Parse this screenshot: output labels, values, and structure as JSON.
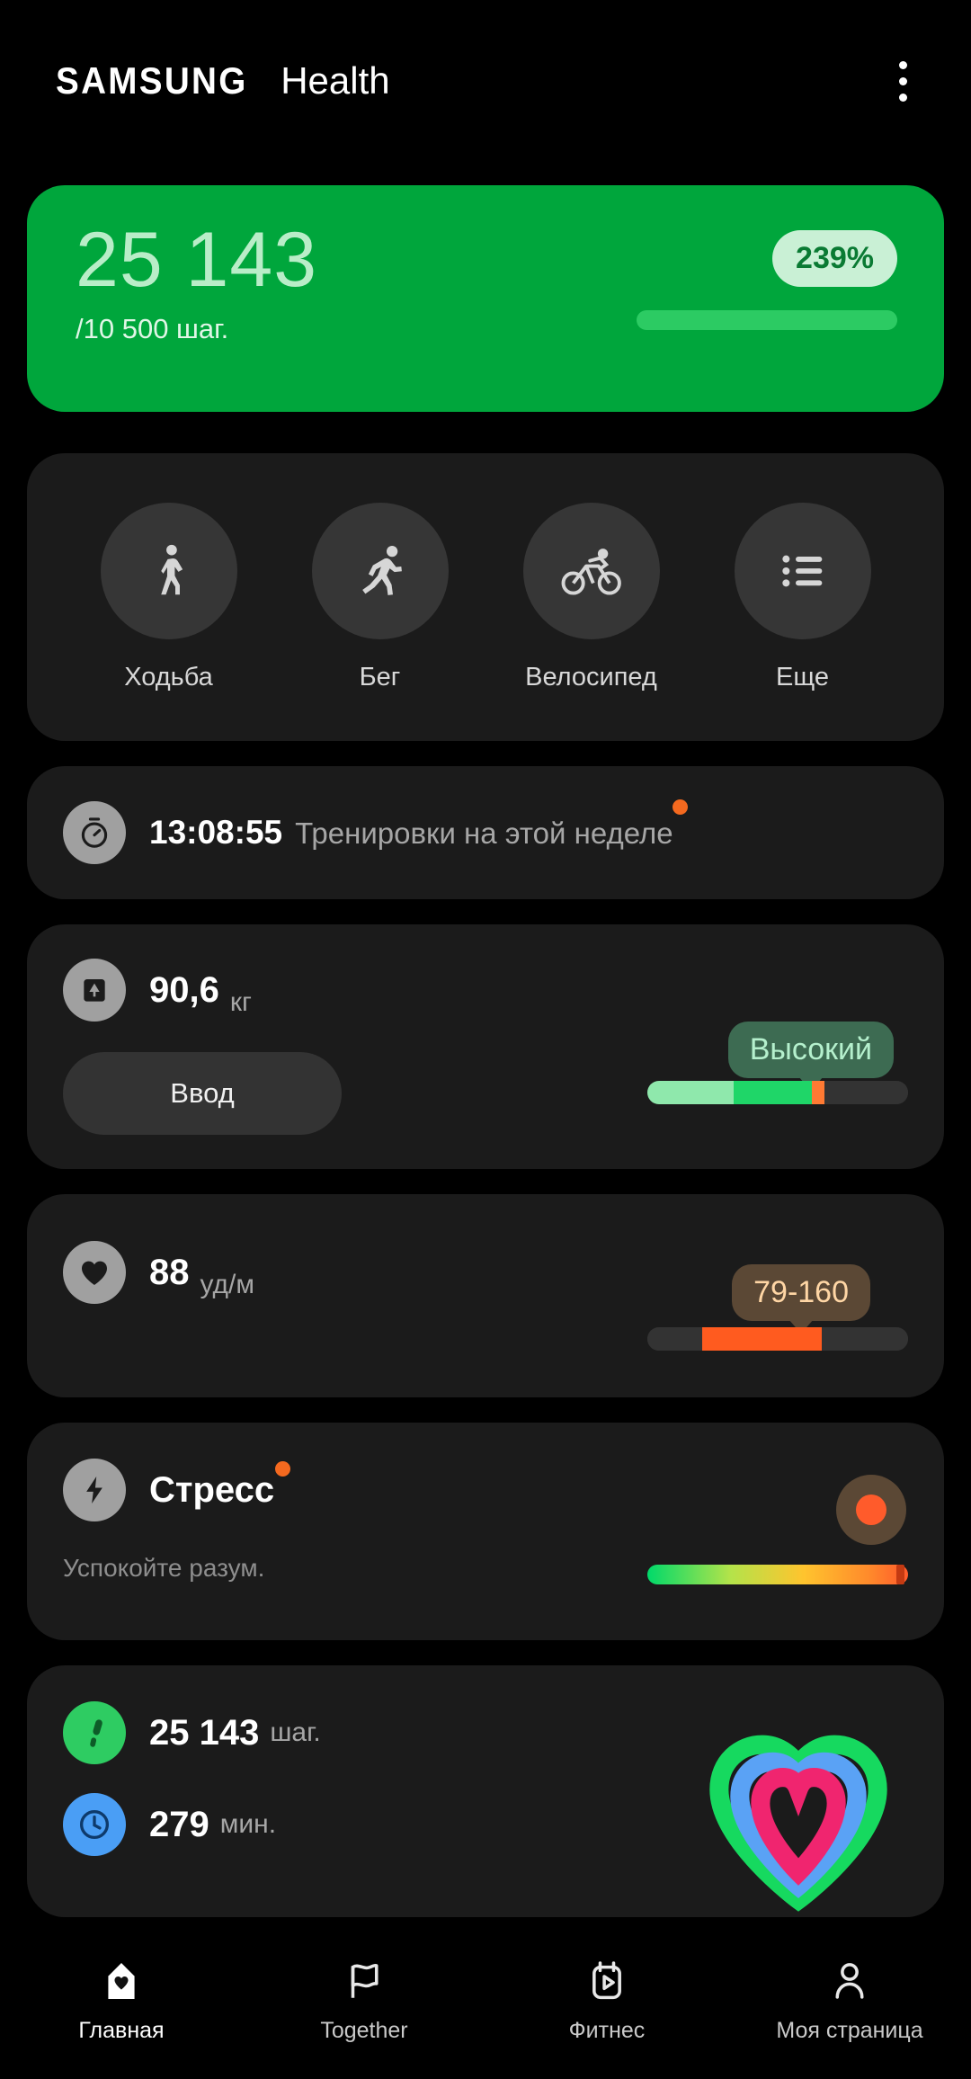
{
  "header": {
    "brand_samsung": "SAMSUNG",
    "brand_health": "Health",
    "menu_icon": "kebab-menu-icon"
  },
  "steps_hero": {
    "steps": "25 143",
    "goal": "/10 500 шаг.",
    "percent": "239%",
    "bar_fill_pct": 100,
    "bg_color": "#00a63c",
    "text_color": "#b9edc8",
    "badge_bg": "#c9f0d5",
    "badge_text_color": "#0a7a33",
    "bar_color": "#2ccb63"
  },
  "shortcuts": {
    "items": [
      {
        "label": "Ходьба",
        "icon": "walking-icon"
      },
      {
        "label": "Бег",
        "icon": "running-icon"
      },
      {
        "label": "Велосипед",
        "icon": "cycling-icon"
      },
      {
        "label": "Еще",
        "icon": "list-more-icon"
      }
    ]
  },
  "workout": {
    "icon": "stopwatch-icon",
    "time": "13:08:55",
    "label": "Тренировки на этой неделе",
    "badge_color": "#f4691f"
  },
  "weight": {
    "icon": "scale-icon",
    "value": "90,6",
    "unit": "кг",
    "input_button": "Ввод",
    "tooltip": "Высокий",
    "tooltip_bg": "#3d6b52",
    "tooltip_text_color": "#b5f0cd",
    "segments": [
      {
        "color": "#8fe8ac",
        "width_pct": 33
      },
      {
        "color": "#1fd668",
        "width_pct": 30
      },
      {
        "color": "#ff7a33",
        "width_pct": 5
      },
      {
        "color": "#333333",
        "width_pct": 32
      }
    ]
  },
  "heart_rate": {
    "icon": "heart-icon",
    "value": "88",
    "unit": "уд/м",
    "tooltip": "79-160",
    "tooltip_bg": "#5b4835",
    "tooltip_text_color": "#ffd6a5",
    "segments": [
      {
        "color": "#333333",
        "width_pct": 21
      },
      {
        "color": "#ff5b1f",
        "width_pct": 46
      },
      {
        "color": "#333333",
        "width_pct": 33
      }
    ]
  },
  "stress": {
    "icon": "lightning-icon",
    "title": "Стресс",
    "subtitle": "Успокойте разум.",
    "badge_color": "#f4691f",
    "indicator_bg": "#5b4835",
    "indicator_dot_color": "#ff5b2b"
  },
  "activity": {
    "steps_icon": "footprint-icon",
    "steps_value": "25 143",
    "steps_unit": "шаг.",
    "steps_icon_color": "#2ecc62",
    "minutes_icon": "clock-icon",
    "minutes_value": "279",
    "minutes_unit": "мин.",
    "minutes_icon_color": "#4a9ef5",
    "rings": {
      "outer_color": "#16d95f",
      "middle_color": "#5aa2f5",
      "inner_color": "#f0256f"
    }
  },
  "bottom_nav": {
    "items": [
      {
        "label": "Главная",
        "icon": "home-heart-icon",
        "active": true
      },
      {
        "label": "Together",
        "icon": "flag-icon",
        "active": false
      },
      {
        "label": "Фитнес",
        "icon": "fitness-play-icon",
        "active": false
      },
      {
        "label": "Моя страница",
        "icon": "person-icon",
        "active": false
      }
    ]
  }
}
